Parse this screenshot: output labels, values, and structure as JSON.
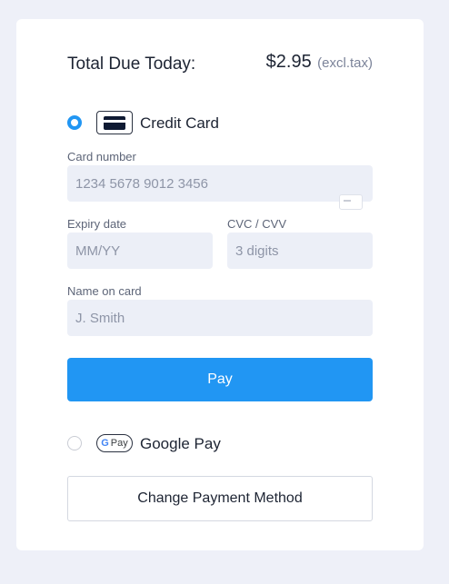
{
  "summary": {
    "label": "Total Due Today:",
    "price": "$2.95",
    "tax_note": "(excl.tax)"
  },
  "methods": {
    "credit_card": {
      "label": "Credit Card",
      "selected": true,
      "icon": "credit-card-icon"
    },
    "google_pay": {
      "label": "Google Pay",
      "selected": false,
      "icon_text_g": "G",
      "icon_text": "Pay"
    }
  },
  "form": {
    "card_number": {
      "label": "Card number",
      "placeholder": "1234 5678 9012 3456",
      "value": ""
    },
    "expiry": {
      "label": "Expiry date",
      "placeholder": "MM/YY",
      "value": ""
    },
    "cvc": {
      "label": "CVC / CVV",
      "placeholder": "3 digits",
      "value": ""
    },
    "name": {
      "label": "Name on card",
      "placeholder": "J. Smith",
      "value": ""
    }
  },
  "buttons": {
    "pay": "Pay",
    "change_method": "Change Payment Method"
  },
  "colors": {
    "accent": "#2196f3",
    "input_bg": "#eceff7",
    "page_bg": "#eef0f8"
  }
}
